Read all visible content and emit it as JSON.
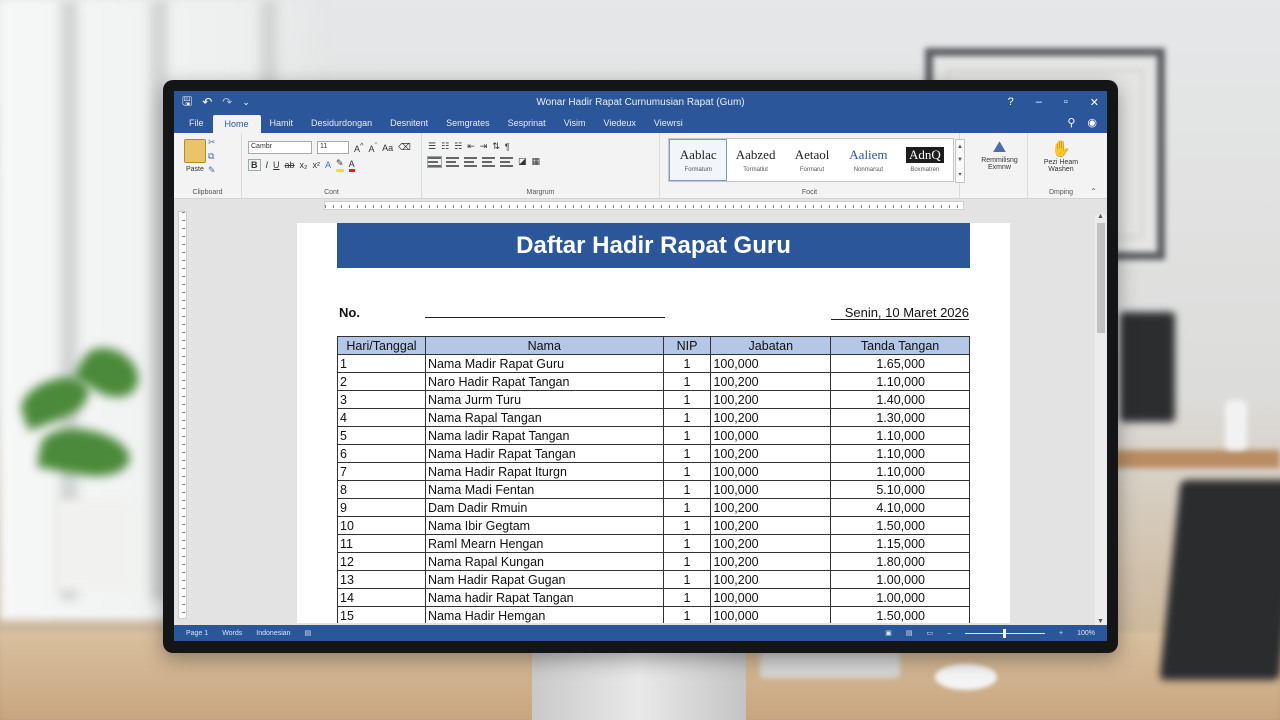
{
  "window": {
    "title": "Wonar Hadir Rapat Curnumusian Rapat (Gum)",
    "controls": {
      "help": "?",
      "minimize": "–",
      "restore": "▫",
      "close": "✕"
    }
  },
  "quick_access": {
    "save": "🖫",
    "undo": "↶",
    "redo": "↷",
    "customize": "⌄"
  },
  "tabs": [
    {
      "label": "File"
    },
    {
      "label": "Home"
    },
    {
      "label": "Hamit"
    },
    {
      "label": "Desidurdongan"
    },
    {
      "label": "Desnitent"
    },
    {
      "label": "Semgrates"
    },
    {
      "label": "Sesprinat"
    },
    {
      "label": "Visim"
    },
    {
      "label": "Viedeux"
    },
    {
      "label": "Viewrsi"
    }
  ],
  "ribbon": {
    "clipboard": {
      "paste_label": "Paste",
      "group_label": "Clipboard"
    },
    "font": {
      "font_name": "Cambr",
      "font_size": "11",
      "group_label": "Cont"
    },
    "paragraph": {
      "group_label": "Margrum"
    },
    "styles": {
      "group_label": "Focit",
      "items": [
        {
          "preview": "Aablac",
          "name": "Formatum"
        },
        {
          "preview": "Aabzed",
          "name": "Tormatlut"
        },
        {
          "preview": "Aetaol",
          "name": "Formarut"
        },
        {
          "preview": "Aaliem",
          "name": "Nonmarsut"
        },
        {
          "preview": "AdnQ",
          "name": "Boxmatren"
        }
      ]
    },
    "editing": {
      "label_1": "Remmilisng",
      "label_2": "Exmnw",
      "group_label": ""
    },
    "dictate": {
      "label_1": "Pezi Heam",
      "label_2": "Washen",
      "group_label": "Dmping"
    }
  },
  "document": {
    "heading": "Daftar Hadir Rapat Guru",
    "no_label": "No.",
    "date": "Senin, 10 Maret 2026",
    "table": {
      "headers": [
        "Hari/Tanggal",
        "Nama",
        "NIP",
        "Jabatan",
        "Tanda Tangan"
      ],
      "rows": [
        [
          "1",
          "Nama Madir Rapat Guru",
          "1",
          "100,000",
          "1.65,000"
        ],
        [
          "2",
          "Naro Hadir Rapat Tangan",
          "1",
          "100,200",
          "1.10,000"
        ],
        [
          "3",
          "Nama Jurm Turu",
          "1",
          "100,200",
          "1.40,000"
        ],
        [
          "4",
          "Nama Rapal Tangan",
          "1",
          "100,200",
          "1.30,000"
        ],
        [
          "5",
          "Nama ladir Rapat Tangan",
          "1",
          "100,000",
          "1.10,000"
        ],
        [
          "6",
          "Nama Hadir Rapat Tangan",
          "1",
          "100,200",
          "1.10,000"
        ],
        [
          "7",
          "Nama Hadir Rapat Iturgn",
          "1",
          "100,000",
          "1.10,000"
        ],
        [
          "8",
          "Nama Madi Fentan",
          "1",
          "100,000",
          "5.10,000"
        ],
        [
          "9",
          "Dam Dadir Rmuin",
          "1",
          "100,200",
          "4.10,000"
        ],
        [
          "10",
          "Nama Ibir Gegtam",
          "1",
          "100,200",
          "1.50,000"
        ],
        [
          "11",
          "Raml Mearn Hengan",
          "1",
          "100,200",
          "1.15,000"
        ],
        [
          "12",
          "Nama Rapal Kungan",
          "1",
          "100,200",
          "1.80,000"
        ],
        [
          "13",
          "Nam Hadir Rapat Gugan",
          "1",
          "100,200",
          "1.00,000"
        ],
        [
          "14",
          "Nama hadir Rapat Tangan",
          "1",
          "100,000",
          "1.00,000"
        ],
        [
          "15",
          "Nama Hadir Hemgan",
          "1",
          "100,000",
          "1.50,000"
        ]
      ]
    }
  },
  "status": {
    "page": "Page 1",
    "words": "Words",
    "lang": "Indonesian",
    "zoom": "100%"
  },
  "colors": {
    "brand": "#2b579a",
    "header_fill": "#b4c7e7"
  }
}
